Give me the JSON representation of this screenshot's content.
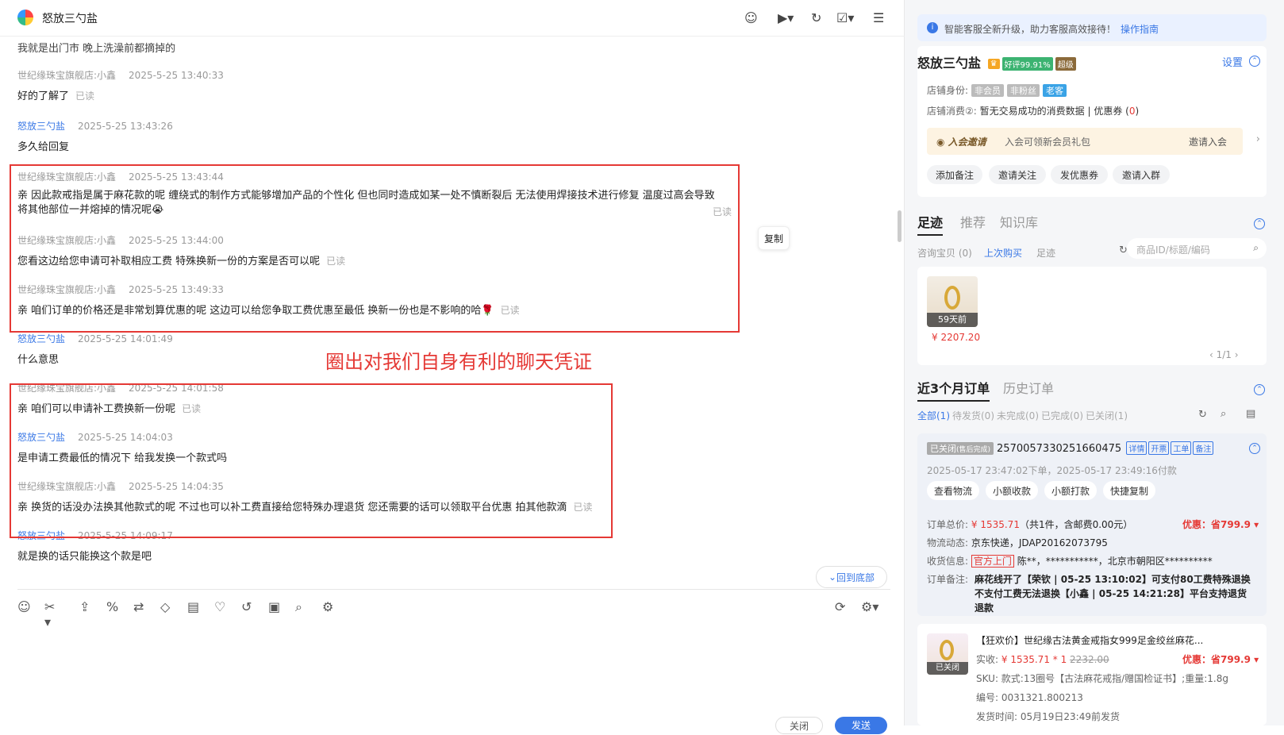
{
  "header": {
    "title": "怒放三勺盐"
  },
  "messages": [
    {
      "text": "我就是出门市 晚上洗澡前都摘掉的"
    },
    {
      "name": "世纪缘珠宝旗舰店:小鑫",
      "time": "2025-5-25 13:40:33",
      "text": "好的了解了",
      "read": "已读"
    },
    {
      "name": "怒放三勺盐",
      "time": "2025-5-25 13:43:26",
      "text": "多久给回复"
    },
    {
      "name": "世纪缘珠宝旗舰店:小鑫",
      "time": "2025-5-25 13:43:44",
      "text": "亲 因此款戒指是属于麻花款的呢 缠绕式的制作方式能够增加产品的个性化 但也同时造成如某一处不慎断裂后 无法使用焊接技术进行修复 温度过高会导致将其他部位一并熔掉的情况呢😭",
      "read": "已读"
    },
    {
      "name": "世纪缘珠宝旗舰店:小鑫",
      "time": "2025-5-25 13:44:00",
      "text": "您看这边给您申请可补取相应工费 特殊换新一份的方案是否可以呢",
      "read": "已读"
    },
    {
      "name": "世纪缘珠宝旗舰店:小鑫",
      "time": "2025-5-25 13:49:33",
      "text": "亲 咱们订单的价格还是非常划算优惠的呢 这边可以给您争取工费优惠至最低 换新一份也是不影响的哈🌹",
      "read": "已读"
    },
    {
      "name": "怒放三勺盐",
      "time": "2025-5-25 14:01:49",
      "text": "什么意思"
    },
    {
      "name": "世纪缘珠宝旗舰店:小鑫",
      "time": "2025-5-25 14:01:58",
      "text": "亲 咱们可以申请补工费换新一份呢",
      "read": "已读"
    },
    {
      "name": "怒放三勺盐",
      "time": "2025-5-25 14:04:03",
      "text": "是申请工费最低的情况下 给我发换一个款式吗"
    },
    {
      "name": "世纪缘珠宝旗舰店:小鑫",
      "time": "2025-5-25 14:04:35",
      "text": "亲 换货的话没办法换其他款式的呢 不过也可以补工费直接给您特殊办理退货 您还需要的话可以领取平台优惠 拍其他款滴",
      "read": "已读"
    },
    {
      "name": "怒放三勺盐",
      "time": "2025-5-25 14:09:17",
      "text": "就是换的话只能换这个款是吧"
    }
  ],
  "annotation": "圈出对我们自身有利的聊天凭证",
  "copy_label": "复制",
  "back_bottom": "回到底部",
  "buttons": {
    "close": "关闭",
    "send": "发送"
  },
  "right": {
    "notice": "智能客服全新升级，助力客服高效接待！",
    "notice_link": "操作指南",
    "user": {
      "name": "怒放三勺盐",
      "rating": "好评99.91%",
      "level": "超级",
      "settings": "设置"
    },
    "identity_label": "店铺身份:",
    "identity_tags": [
      "非会员",
      "非粉丝",
      "老客"
    ],
    "consume_label": "店铺消费②:",
    "consume_text": "暂无交易成功的消费数据 | 优惠券 (",
    "consume_count": "0",
    "consume_end": ")",
    "vip_title": "入会邀请",
    "vip_text": "入会可领新会员礼包",
    "vip_btn": "邀请入会",
    "actions": [
      "添加备注",
      "邀请关注",
      "发优惠券",
      "邀请入群"
    ],
    "tabs": [
      "足迹",
      "推荐",
      "知识库"
    ],
    "subtabs": [
      "咨询宝贝 (0)",
      "上次购买",
      "足迹"
    ],
    "search_placeholder": "商品ID/标题/编码",
    "product": {
      "label": "59天前",
      "price": "¥ 2207.20",
      "page": "1/1"
    },
    "order_tabs": [
      "近3个月订单",
      "历史订单"
    ],
    "order_filters": [
      "全部(1)",
      "待发货(0)",
      "未完成(0)",
      "已完成(0)",
      "已关闭(1)"
    ],
    "order": {
      "status": "已关闭",
      "status_sub": "(售后完成)",
      "id": "2570057330251660475",
      "tags": [
        "详情",
        "开票",
        "工单",
        "备注"
      ],
      "times": "2025-05-17 23:47:02下单，2025-05-17 23:49:16付款",
      "actions": [
        "查看物流",
        "小额收款",
        "小额打款",
        "快捷复制"
      ],
      "total_label": "订单总价:",
      "total": "¥ 1535.71",
      "total_note": "（共1件，含邮费0.00元）",
      "discount": "优惠：省799.9",
      "logistics_label": "物流动态:",
      "logistics": "京东快递，JDAP20162073795",
      "address_label": "收货信息:",
      "address_tag": "官方上门",
      "address": "陈**，***********，北京市朝阳区**********",
      "remark_label": "订单备注:",
      "remark": "麻花线开了【荣钦 | 05-25 13:10:02】可支付80工费特殊退换 不支付工费无法退换【小鑫 | 05-25 14:21:28】平台支持退货退款"
    },
    "item": {
      "title": "【狂欢价】世纪缘古法黄金戒指女999足金绞丝麻花...",
      "paid_label": "实收:",
      "paid": "¥ 1535.71 * 1",
      "orig": "2232.00",
      "discount": "优惠：省799.9",
      "sku": "SKU: 款式:13圈号【古法麻花戒指/赠国检证书】;重量:1.8g",
      "code": "编号: 0031321.800213",
      "ship": "发货时间: 05月19日23:49前发货",
      "thumb_label": "已关闭"
    }
  },
  "colors": {
    "accent": "#3a78e6",
    "annotation": "#e53935"
  }
}
